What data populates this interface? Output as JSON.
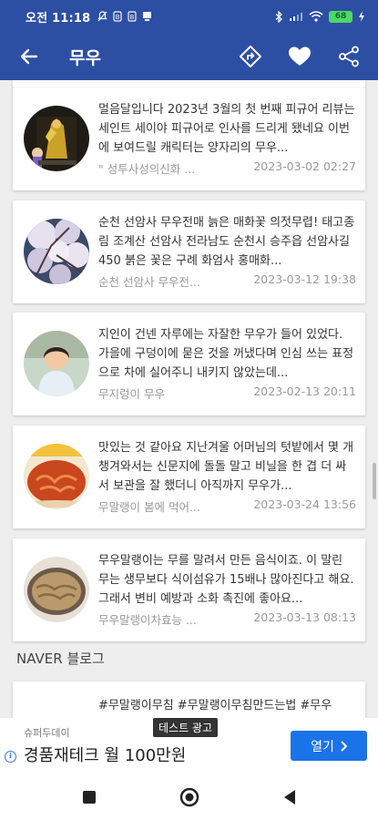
{
  "status_bar": {
    "time": "오전 11:18",
    "battery": "68"
  },
  "app_bar": {
    "title": "무우"
  },
  "cards": [
    {
      "snippet": "멀음달입니다 2023년 3월의 첫 번째 피규어 리뷰는 세인트 세이야 피규어로 인사를 드리게 됐네요 이번에 보여드릴 캐릭터는 양자리의 무우...",
      "source": "\" 성투사성의신화 ...",
      "date": "2023-03-02 02:27"
    },
    {
      "snippet": "순천 선암사 무우전매 늙은 매화꽃 의젓무렵! 태고종림 조계산 선암사 전라남도 순천시 승주읍 선암사길 450 붉은 꽃은 구례 화엄사 홍매화...",
      "source": "순천 선암사 무우전...",
      "date": "2023-03-12 19:38"
    },
    {
      "snippet": "지인이 건넨 자루에는 자잘한 무우가 들어 있었다. 가을에 구덩이에 묻은 것을 꺼냈다며 인심 쓰는 표정으로 차에 실어주니 내키지 않았는데...",
      "source": "무지렁이 무우",
      "date": "2023-02-13 20:11"
    },
    {
      "snippet": "맛있는 것 같아요 지난겨울 어머님의 텃밭에서 몇 개 챙겨와서는 신문지에 돌돌 말고 비닐을 한 겹 더 싸서 보관을 잘 했더니 아직까지 무우가...",
      "source": "무말랭이 봄에 먹어...",
      "date": "2023-03-24 13:56"
    },
    {
      "snippet": "무우말랭이는 무를 말려서 만든 음식이죠. 이 말린 무는 생무보다 식이섬유가 15배나 많아진다고 해요. 그래서 변비 예방과 소화 촉진에 좋아요...",
      "source": "무우말랭이차효능 ...",
      "date": "2023-03-13 08:13"
    }
  ],
  "section_label": "NAVER 블로그",
  "partial_card": {
    "snippet": "#무말랭이무침 #무말랭이무침만드는법 #무우"
  },
  "ad": {
    "badge": "테스트 광고",
    "advertiser": "슈퍼두데이",
    "headline": "경품재테크 월 100만원",
    "cta": "열기",
    "info": "i"
  }
}
